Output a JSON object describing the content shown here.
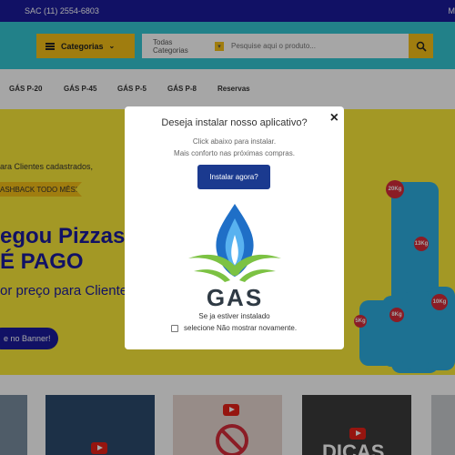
{
  "topbar": {
    "sac": "SAC (11) 2554-6803",
    "right": "M"
  },
  "header": {
    "categories_label": "Categorias",
    "search_category": "Todas Categorias",
    "search_placeholder": "Pesquise aqui o produto..."
  },
  "nav": {
    "items": [
      "GÁS P-20",
      "GÁS P-45",
      "GÁS P-5",
      "GÁS P-8",
      "Reservas"
    ]
  },
  "banner": {
    "line1": "ara Clientes cadastrados,",
    "cashback": "ASHBACK TODO MÊS!",
    "headline1": "egou Pizzas",
    "headline2": "É PAGO",
    "line2": "or preço para Cliente",
    "cta": "e no Banner!",
    "cylinder_tags": [
      "20Kg",
      "8Kg",
      "13Kg",
      "5Kg",
      "10Kg"
    ]
  },
  "bottom": {
    "video_text": "DICAS"
  },
  "modal": {
    "title": "Deseja instalar nosso aplicativo?",
    "subtitle1": "Click abaixo para instalar.",
    "subtitle2": "Mais conforto nas próximas compras.",
    "install_label": "Instalar agora?",
    "logo_text": "GAS",
    "installed_note": "Se ja estiver instalado",
    "dont_show_label": "selecione Não mostrar novamente.",
    "close_label": "×"
  },
  "colors": {
    "brand_blue": "#1b1b9c",
    "accent_yellow": "#f6c118",
    "header_cyan": "#35c7d3",
    "banner_yellow": "#fbea3a"
  },
  "icons": [
    "hamburger-icon",
    "chevron-down-icon",
    "search-icon",
    "close-icon",
    "youtube-play-icon",
    "flame-icon"
  ]
}
